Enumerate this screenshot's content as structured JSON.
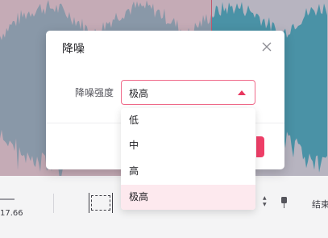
{
  "editor": {
    "time_readout": "17.66",
    "end_label": "结束"
  },
  "dialog": {
    "title": "降噪",
    "close_icon": "close-icon",
    "field_label": "降噪强度",
    "selected_value": "极高",
    "options": [
      "低",
      "中",
      "高",
      "极高"
    ],
    "selected_index": 3
  },
  "colors": {
    "accent": "#ef3f68",
    "selected_option_bg": "#fde9ee",
    "waveform_left": "#4a92a6",
    "waveform_right": "#4a86a0"
  }
}
